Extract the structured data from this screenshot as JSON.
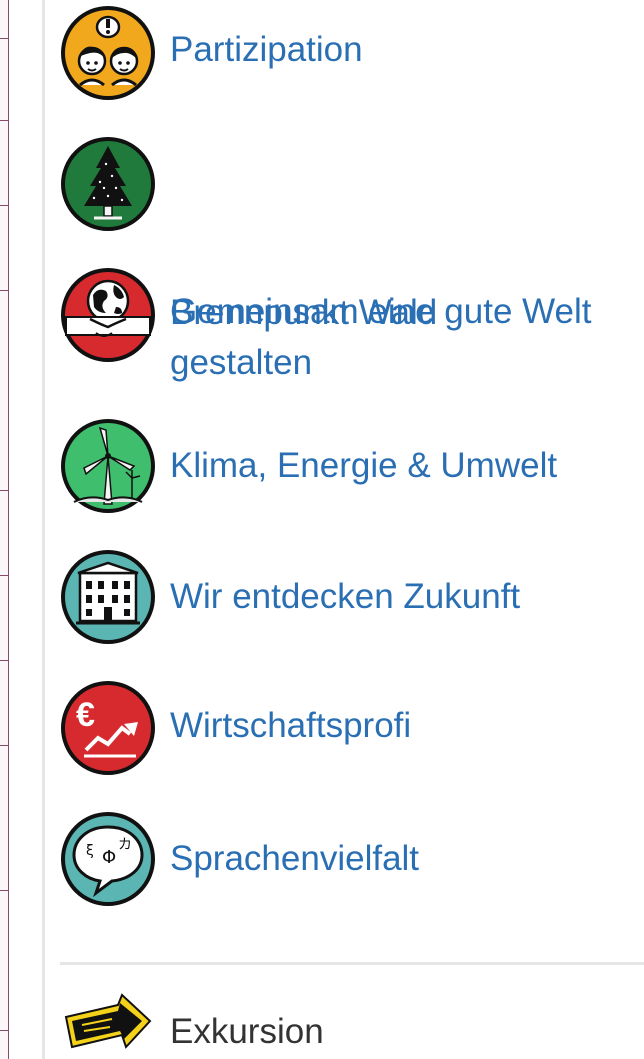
{
  "menu": {
    "items": [
      {
        "label": "Partizipation",
        "icon": "participation-icon",
        "bg": "#f2a81d"
      },
      {
        "label": "Brennpunkt Wald",
        "icon": "forest-tree-icon",
        "bg": "#1f7a3c"
      },
      {
        "label_line1": "Gemeinsam eine gute Welt",
        "label_line2": "gestalten",
        "icon": "globe-handshake-icon",
        "bg": "#d72a2f"
      },
      {
        "label": "Klima, Energie & Umwelt",
        "icon": "wind-turbine-icon",
        "bg": "#3fbf6e"
      },
      {
        "label": "Wir entdecken Zukunft",
        "icon": "building-icon",
        "bg": "#5ab5b3"
      },
      {
        "label": "Wirtschaftsprofi",
        "icon": "euro-chart-icon",
        "bg": "#d72a2f"
      },
      {
        "label": "Sprachenvielfalt",
        "icon": "speech-bubble-icon",
        "bg": "#5ab5b3"
      }
    ],
    "extra": {
      "label": "Exkursion",
      "icon": "excursion-sign-icon",
      "bg": "#f5d21a"
    }
  },
  "colors": {
    "link": "#2a6fb3",
    "text_dark": "#333333",
    "divider": "#e6e6e6"
  }
}
